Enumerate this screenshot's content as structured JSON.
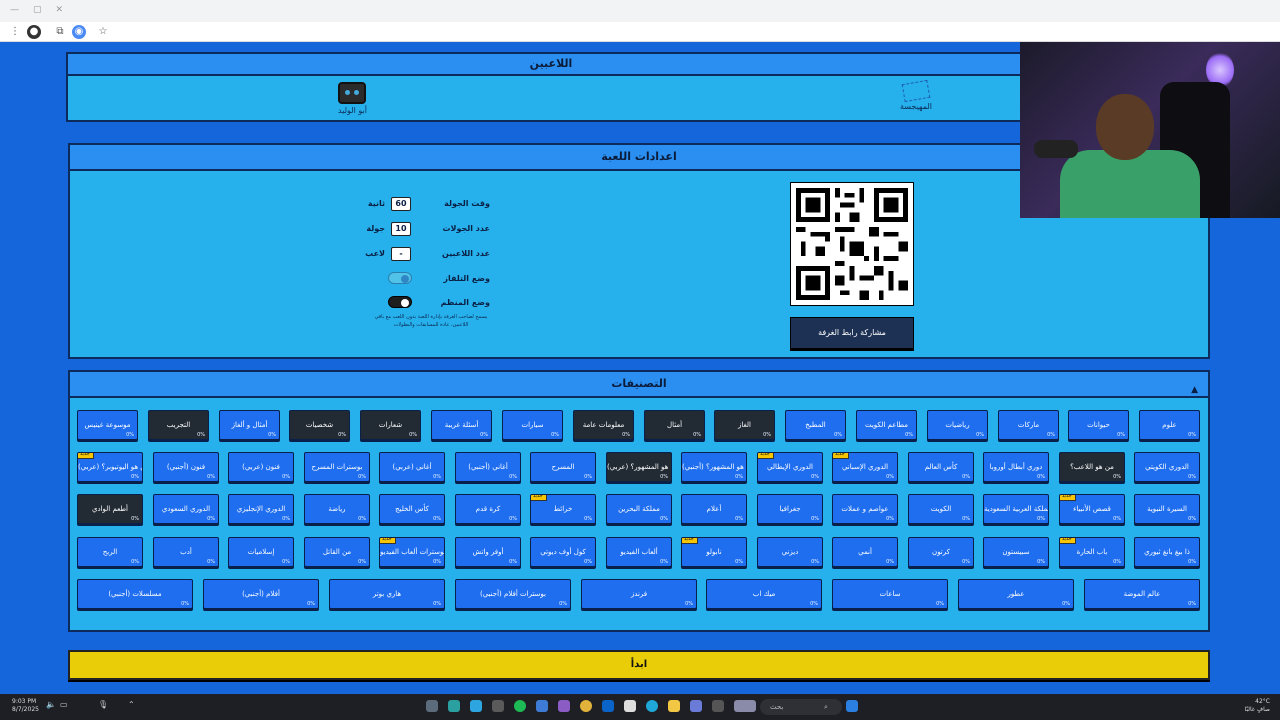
{
  "players": {
    "title": "اللاعبين",
    "list": [
      {
        "name": "أبو الوليد"
      },
      {
        "name": "المهيجسة"
      }
    ]
  },
  "settings": {
    "title": "اعدادات اللعبة",
    "rounds_time": {
      "label": "وقت الجولة",
      "value": "60",
      "unit": "ثانية"
    },
    "rounds_count": {
      "label": "عدد الجولات",
      "value": "10",
      "unit": "جولة"
    },
    "players_count": {
      "label": "عدد اللاعبين",
      "value": "-",
      "unit": "لاعب"
    },
    "tv_mode": {
      "label": "وضع التلفاز",
      "on": true
    },
    "organizer_mode": {
      "label": "وضع المنظم",
      "on": false
    },
    "organizer_note": "يسمح لصاحب الغرفة بإدارة اللعبة بدون اللعب مع باقي اللاعبين، عادة للمسابقات والبطولات",
    "share_button": "مشاركة رابط الغرفة"
  },
  "categories": {
    "title": "التصنيفات",
    "collapse_icon": "chevron-up-icon",
    "badge_label": "جديد",
    "rows": [
      [
        {
          "label": "علوم",
          "pct": "0%"
        },
        {
          "label": "حيوانات",
          "pct": "0%"
        },
        {
          "label": "ماركات",
          "pct": "0%"
        },
        {
          "label": "رياضيات",
          "pct": "0%"
        },
        {
          "label": "مطاعم الكويت",
          "pct": "0%"
        },
        {
          "label": "المطبخ",
          "pct": "0%"
        },
        {
          "label": "الغاز",
          "pct": "0%",
          "dark": true
        },
        {
          "label": "أمثال",
          "pct": "0%",
          "dark": true
        },
        {
          "label": "معلومات عامة",
          "pct": "0%",
          "dark": true
        },
        {
          "label": "سيارات",
          "pct": "0%"
        },
        {
          "label": "أسئلة غريبة",
          "pct": "0%"
        },
        {
          "label": "شعارات",
          "pct": "0%",
          "dark": true
        },
        {
          "label": "شخصيات",
          "pct": "0%",
          "dark": true
        },
        {
          "label": "أمثال و ألغاز",
          "pct": "0%"
        },
        {
          "label": "التجريب",
          "pct": "0%",
          "dark": true
        },
        {
          "label": "موسوعة غينيس",
          "pct": "0%"
        }
      ],
      [
        {
          "label": "الدوري الكويتي",
          "pct": "0%"
        },
        {
          "label": "من هو اللاعب؟",
          "pct": "0%",
          "dark": true
        },
        {
          "label": "دوري أبطال أوروبا",
          "pct": "0%"
        },
        {
          "label": "كأس العالم",
          "pct": "0%"
        },
        {
          "label": "الدوري الإسباني",
          "pct": "0%",
          "badge": true
        },
        {
          "label": "الدوري الإيطالي",
          "pct": "0%",
          "badge": true
        },
        {
          "label": "من هو المشهور؟ (أجنبي)",
          "pct": "0%"
        },
        {
          "label": "من هو المشهور؟ (عربي)",
          "pct": "0%",
          "dark": true
        },
        {
          "label": "المسرح",
          "pct": "0%"
        },
        {
          "label": "أغاني (أجنبي)",
          "pct": "0%"
        },
        {
          "label": "أغاني (عربي)",
          "pct": "0%"
        },
        {
          "label": "بوسترات المسرح",
          "pct": "0%"
        },
        {
          "label": "فنون (عربي)",
          "pct": "0%"
        },
        {
          "label": "فنون (أجنبي)",
          "pct": "0%"
        },
        {
          "label": "من هو اليوتيوبر؟ (عربي)",
          "pct": "0%",
          "badge": true
        }
      ],
      [
        {
          "label": "السيرة النبوية",
          "pct": "0%"
        },
        {
          "label": "قصص الأنبياء",
          "pct": "0%",
          "badge": true
        },
        {
          "label": "المملكة العربية السعودية",
          "pct": "0%"
        },
        {
          "label": "الكويت",
          "pct": "0%"
        },
        {
          "label": "عواصم و عملات",
          "pct": "0%"
        },
        {
          "label": "جغرافيا",
          "pct": "0%"
        },
        {
          "label": "أعلام",
          "pct": "0%"
        },
        {
          "label": "مملكة البحرين",
          "pct": "0%"
        },
        {
          "label": "خرائط",
          "pct": "0%",
          "badge": true
        },
        {
          "label": "كرة قدم",
          "pct": "0%"
        },
        {
          "label": "كأس الخليج",
          "pct": "0%"
        },
        {
          "label": "رياضة",
          "pct": "0%"
        },
        {
          "label": "الدوري الإنجليزي",
          "pct": "0%"
        },
        {
          "label": "الدوري السعودي",
          "pct": "0%"
        },
        {
          "label": "أطعم الوادي",
          "pct": "0%",
          "dark": true
        }
      ],
      [
        {
          "label": "ذا بيغ بانغ ثيوري",
          "pct": "0%"
        },
        {
          "label": "باب الحارة",
          "pct": "0%",
          "badge": true
        },
        {
          "label": "سبيستون",
          "pct": "0%"
        },
        {
          "label": "كرتون",
          "pct": "0%"
        },
        {
          "label": "أنمي",
          "pct": "0%"
        },
        {
          "label": "ديزني",
          "pct": "0%"
        },
        {
          "label": "نابولو",
          "pct": "0%",
          "badge": true
        },
        {
          "label": "ألعاب الفيديو",
          "pct": "0%"
        },
        {
          "label": "كول أوف ديوتي",
          "pct": "0%"
        },
        {
          "label": "أوفر واتش",
          "pct": "0%"
        },
        {
          "label": "بوسترات ألعاب الفيديو",
          "pct": "0%",
          "badge": true
        },
        {
          "label": "من القاتل",
          "pct": "0%"
        },
        {
          "label": "إسلاميات",
          "pct": "0%"
        },
        {
          "label": "أدب",
          "pct": "0%"
        },
        {
          "label": "الربح",
          "pct": "0%"
        }
      ],
      [
        {
          "label": "عالم الموضة",
          "pct": "0%"
        },
        {
          "label": "عطور",
          "pct": "0%"
        },
        {
          "label": "ساعات",
          "pct": "0%"
        },
        {
          "label": "ميك اب",
          "pct": "0%"
        },
        {
          "label": "فرندز",
          "pct": "0%"
        },
        {
          "label": "بوسترات أفلام (أجنبي)",
          "pct": "0%"
        },
        {
          "label": "هاري بوتر",
          "pct": "0%"
        },
        {
          "label": "أفلام (أجنبي)",
          "pct": "0%"
        },
        {
          "label": "مسلسلات (أجنبي)",
          "pct": "0%"
        }
      ]
    ]
  },
  "start_button": "ابدأ",
  "taskbar": {
    "time": "9:03 PM",
    "date": "8/7/2025",
    "search_placeholder": "بحث",
    "temperature": "42°C",
    "weather": "صافٍ غالبًا"
  }
}
